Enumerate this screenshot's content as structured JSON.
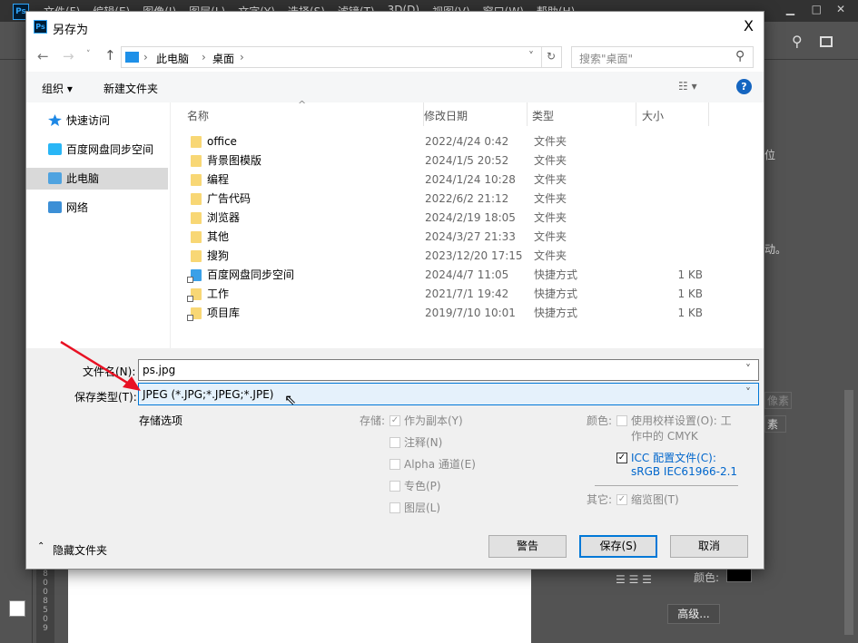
{
  "ps": {
    "logo": "Ps",
    "menu": [
      "文件(F)",
      "编辑(E)",
      "图像(I)",
      "图层(L)",
      "文字(Y)",
      "选择(S)",
      "滤镜(T)",
      "3D(D)",
      "视图(V)",
      "窗口(W)",
      "帮助(H)"
    ],
    "right_panel": {
      "text1": "位",
      "text2": "动。",
      "text3": "像素",
      "text4": "素",
      "color_label": "颜色:",
      "advanced_button": "高级..."
    },
    "ruler": [
      "8",
      "0",
      "0",
      "8",
      "5",
      "0",
      "9"
    ]
  },
  "dialog": {
    "title": "另存为",
    "close": "X",
    "breadcrumb": [
      "此电脑",
      "桌面"
    ],
    "search_placeholder": "搜索\"桌面\"",
    "toolbar": {
      "organize": "组织 ▾",
      "new_folder": "新建文件夹",
      "help": "?"
    },
    "nav": [
      {
        "label": "快速访问",
        "icon": "star-icon"
      },
      {
        "label": "百度网盘同步空间",
        "icon": "baidu-netdisk-icon"
      },
      {
        "label": "此电脑",
        "icon": "computer-icon",
        "selected": true
      },
      {
        "label": "网络",
        "icon": "network-icon"
      }
    ],
    "columns": [
      "名称",
      "修改日期",
      "类型",
      "大小"
    ],
    "files": [
      {
        "name": "office",
        "date": "2022/4/24 0:42",
        "type": "文件夹",
        "size": "",
        "icon": "folder-icon"
      },
      {
        "name": "背景图模版",
        "date": "2024/1/5 20:52",
        "type": "文件夹",
        "size": "",
        "icon": "folder-icon"
      },
      {
        "name": "编程",
        "date": "2024/1/24 10:28",
        "type": "文件夹",
        "size": "",
        "icon": "folder-icon"
      },
      {
        "name": "广告代码",
        "date": "2022/6/2 21:12",
        "type": "文件夹",
        "size": "",
        "icon": "folder-icon"
      },
      {
        "name": "浏览器",
        "date": "2024/2/19 18:05",
        "type": "文件夹",
        "size": "",
        "icon": "folder-icon"
      },
      {
        "name": "其他",
        "date": "2024/3/27 21:33",
        "type": "文件夹",
        "size": "",
        "icon": "folder-icon"
      },
      {
        "name": "搜狗",
        "date": "2023/12/20 17:15",
        "type": "文件夹",
        "size": "",
        "icon": "folder-icon"
      },
      {
        "name": "百度网盘同步空间",
        "date": "2024/4/7 11:05",
        "type": "快捷方式",
        "size": "1 KB",
        "icon": "shortcut-icon"
      },
      {
        "name": "工作",
        "date": "2021/7/1 19:42",
        "type": "快捷方式",
        "size": "1 KB",
        "icon": "shortcut-icon"
      },
      {
        "name": "项目库",
        "date": "2019/7/10 10:01",
        "type": "快捷方式",
        "size": "1 KB",
        "icon": "shortcut-icon"
      }
    ],
    "filename_label": "文件名(N):",
    "filename_value": "ps.jpg",
    "filetype_label": "保存类型(T):",
    "filetype_value": "JPEG (*.JPG;*.JPEG;*.JPE)",
    "options_title": "存储选项",
    "save_label": "存储:",
    "save_options": [
      {
        "label": "作为副本(Y)",
        "checked": true,
        "disabled": true
      },
      {
        "label": "注释(N)",
        "checked": false
      },
      {
        "label": "Alpha 通道(E)",
        "checked": false
      },
      {
        "label": "专色(P)",
        "checked": false
      },
      {
        "label": "图层(L)",
        "checked": false
      }
    ],
    "color_label": "颜色:",
    "proof_label": "使用校样设置(O): 工",
    "proof_label2": "作中的 CMYK",
    "icc_label": "ICC 配置文件(C):",
    "icc_value": "sRGB IEC61966-2.1",
    "other_label": "其它:",
    "thumbnail_label": "缩览图(T)",
    "hide_folders": "隐藏文件夹",
    "buttons": {
      "warning": "警告",
      "save": "保存(S)",
      "cancel": "取消"
    }
  },
  "colors": {
    "accent": "#0078d7",
    "folder": "#f8d775",
    "annotation_arrow": "#e81123"
  }
}
